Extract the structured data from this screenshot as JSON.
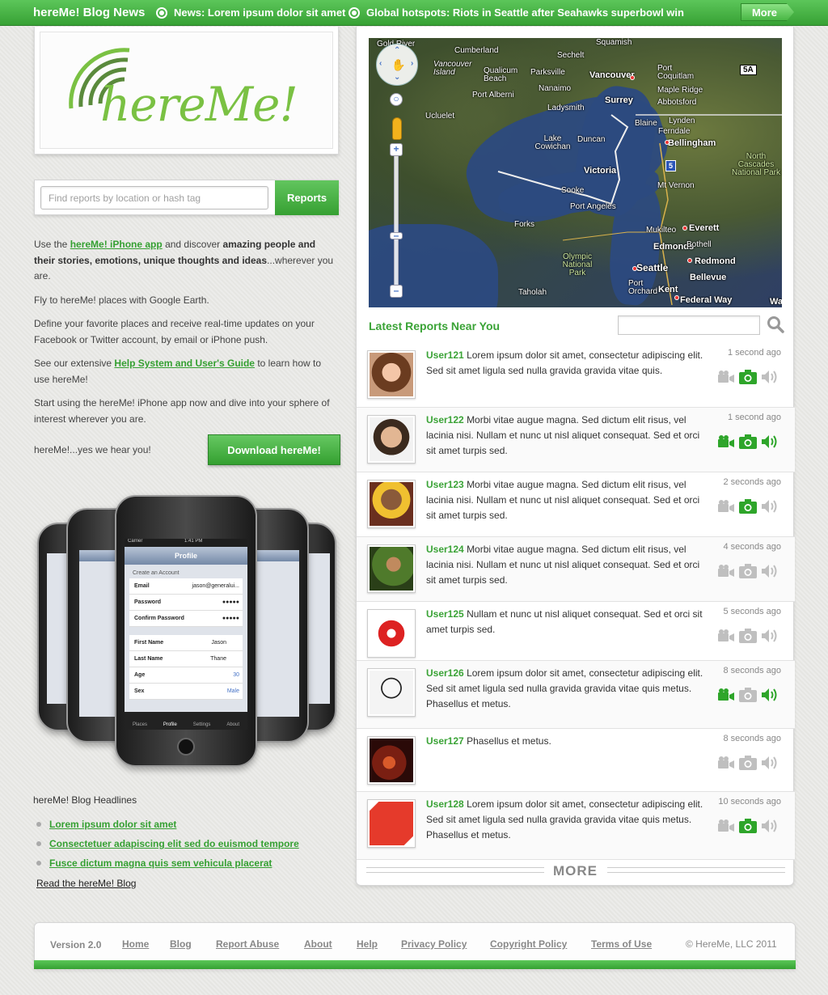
{
  "topbar": {
    "brand": "hereMe! Blog News",
    "news1": "News: Lorem ipsum dolor sit amet",
    "news2": "Global hotspots: Riots in Seattle after Seahawks superbowl win",
    "more_label": "More"
  },
  "logo": {
    "text": "hereMe!"
  },
  "search": {
    "placeholder": "Find reports by location or hash tag",
    "button_label": "Reports"
  },
  "intro": {
    "p1_pre": "Use the ",
    "p1_link": "hereMe! iPhone app",
    "p1_mid": " and discover ",
    "p1_bold": "amazing people and their stories, emotions, unique thoughts and ideas",
    "p1_post": "...wherever you are.",
    "p2": "Fly to hereMe! places with Google Earth.",
    "p3": "Define your favorite places and receive real-time updates on your Facebook or Twitter account, by email or iPhone push.",
    "p4_pre": "See our extensive ",
    "p4_link": "Help System and User's Guide",
    "p4_post": " to learn how to use hereMe!",
    "p5": "Start using the hereMe! iPhone app now and dive into your sphere of interest wherever you are.",
    "hear_you": "hereMe!...yes we hear you!",
    "download_label": "Download hereMe!"
  },
  "phone": {
    "carrier": "Carrier",
    "time": "1:41 PM",
    "screen_title": "Profile",
    "section": "Create an Account",
    "fields": [
      {
        "label": "Email",
        "value": "jason@generalui..."
      },
      {
        "label": "Password",
        "value": "●●●●●"
      },
      {
        "label": "Confirm Password",
        "value": "●●●●●"
      }
    ],
    "fields2": [
      {
        "label": "First Name",
        "value": "Jason"
      },
      {
        "label": "Last Name",
        "value": "Thane"
      },
      {
        "label": "Age",
        "value": "30"
      },
      {
        "label": "Sex",
        "value": "Male"
      }
    ],
    "tabs": [
      "Places",
      "Profile",
      "Settings",
      "About"
    ]
  },
  "blog": {
    "heading": "hereMe! Blog Headlines",
    "items": [
      "Lorem ipsum dolor sit amet",
      "Consectetuer adapiscing elit sed do euismod tempore",
      "Fusce dictum magna quis sem vehicula placerat"
    ],
    "read_link": "Read the hereMe! Blog"
  },
  "map": {
    "places": [
      "Squamish",
      "Cumberland",
      "Sechelt",
      "Qualicum Beach",
      "Parksville",
      "Vancouver",
      "Port Coquitlam",
      "Nanaimo",
      "Maple Ridge",
      "Surrey",
      "Abbotsford",
      "Port Alberni",
      "Ladysmith",
      "Vancouver Island",
      "Ucluelet",
      "Blaine",
      "Lynden",
      "Ferndale",
      "Bellingham",
      "Lake Cowichan",
      "Duncan",
      "North Cascades National Park",
      "Victoria",
      "Mt Vernon",
      "Sooke",
      "Port Angeles",
      "Forks",
      "Mukilteo",
      "Everett",
      "Edmonds",
      "Bothell",
      "Olympic National Park",
      "Seattle",
      "Redmond",
      "Bellevue",
      "Port Orchard",
      "Kent",
      "Taholah",
      "Federal Way",
      "Gold River",
      "5A",
      "5",
      "Wa"
    ]
  },
  "latest": {
    "title": "Latest Reports Near You",
    "reports": [
      {
        "user": "User121",
        "text": "Lorem ipsum dolor sit amet, consectetur adipiscing elit. Sed sit amet ligula sed nulla gravida gravida vitae quis.",
        "time": "1 second ago",
        "video": false,
        "photo": true,
        "audio": false
      },
      {
        "user": "User122",
        "text": "Morbi vitae augue magna. Sed dictum elit risus, vel lacinia nisi. Nullam et nunc ut nisl aliquet consequat. Sed et orci sit amet turpis sed.",
        "time": "1 second ago",
        "video": true,
        "photo": true,
        "audio": true
      },
      {
        "user": "User123",
        "text": "Morbi vitae augue magna. Sed dictum elit risus, vel lacinia nisi. Nullam et nunc ut nisl aliquet consequat. Sed et orci sit amet turpis sed.",
        "time": "2 seconds ago",
        "video": false,
        "photo": true,
        "audio": false
      },
      {
        "user": "User124",
        "text": "Morbi vitae augue magna. Sed dictum elit risus, vel lacinia nisi. Nullam et nunc ut nisl aliquet consequat. Sed et orci sit amet turpis sed.",
        "time": "4 seconds ago",
        "video": false,
        "photo": false,
        "audio": false
      },
      {
        "user": "User125",
        "text": "Nullam et nunc ut nisl aliquet consequat. Sed et orci sit amet turpis sed.",
        "time": "5 seconds ago",
        "video": false,
        "photo": false,
        "audio": false
      },
      {
        "user": "User126",
        "text": "Lorem ipsum dolor sit amet, consectetur adipiscing elit. Sed sit amet ligula sed nulla gravida gravida vitae quis metus. Phasellus et metus.",
        "time": "8 seconds ago",
        "video": true,
        "photo": false,
        "audio": true
      },
      {
        "user": "User127",
        "text": " Phasellus et metus.",
        "time": "8 seconds ago",
        "video": false,
        "photo": false,
        "audio": false
      },
      {
        "user": "User128",
        "text": "Lorem ipsum dolor sit amet, consectetur adipiscing elit. Sed sit amet ligula sed nulla gravida gravida vitae quis metus. Phasellus et metus.",
        "time": "10 seconds ago",
        "video": false,
        "photo": true,
        "audio": false
      }
    ],
    "more_label": "MORE"
  },
  "footer": {
    "version": "Version 2.0",
    "links": [
      "Home",
      "Blog",
      "Report Abuse",
      "About",
      "Help",
      "Privacy Policy",
      "Copyright Policy",
      "Terms of Use"
    ],
    "copyright": "© HereMe, LLC 2011"
  },
  "colors": {
    "brand_green": "#3aa336",
    "active_icon": "#2ea52a",
    "inactive_icon": "#bfbfbf"
  }
}
